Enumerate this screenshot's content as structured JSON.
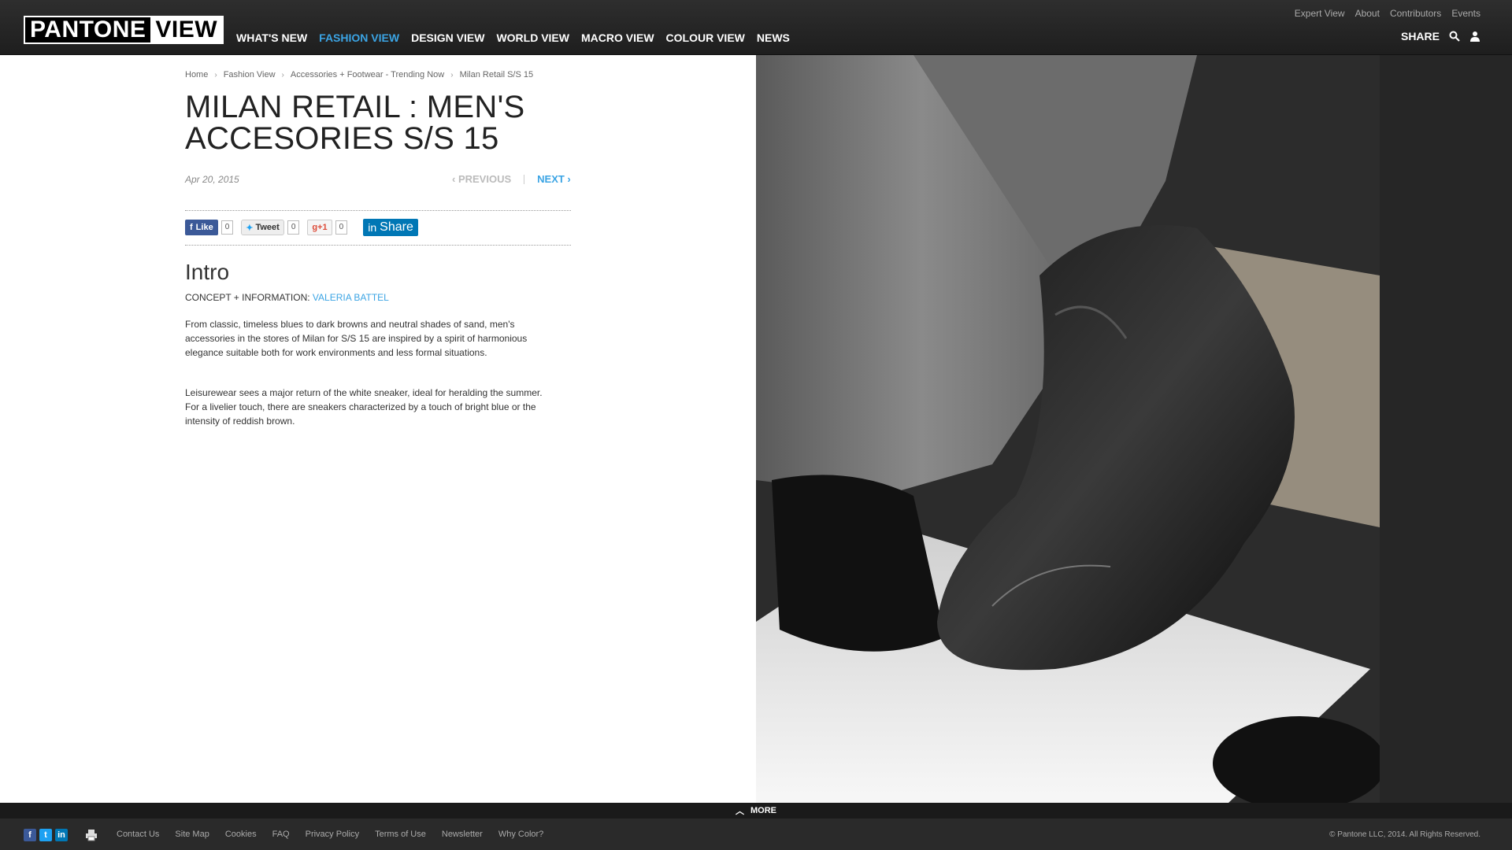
{
  "header": {
    "logo_left": "PANTONE",
    "logo_right": "VIEW",
    "main_nav": [
      {
        "label": "WHAT'S NEW"
      },
      {
        "label": "FASHION VIEW",
        "active": true
      },
      {
        "label": "DESIGN VIEW"
      },
      {
        "label": "WORLD VIEW"
      },
      {
        "label": "MACRO VIEW"
      },
      {
        "label": "COLOUR VIEW"
      },
      {
        "label": "NEWS"
      }
    ],
    "top_nav": [
      "Expert View",
      "About",
      "Contributors",
      "Events"
    ],
    "share_label": "SHARE"
  },
  "breadcrumb": [
    "Home",
    "Fashion View",
    "Accessories + Footwear - Trending Now",
    "Milan Retail S/S 15"
  ],
  "article": {
    "title": "MILAN RETAIL : MEN'S ACCESORIES S/S 15",
    "date": "Apr 20, 2015",
    "prev_label": "PREVIOUS",
    "next_label": "NEXT",
    "intro_heading": "Intro",
    "concept_label": "CONCEPT + INFORMATION:",
    "author": "VALERIA BATTEL",
    "paragraphs": [
      "From classic, timeless blues to dark browns and neutral shades of sand, men's accessories in the stores of Milan for S/S 15 are inspired by a spirit of harmonious elegance suitable both for work environments and less formal situations.",
      "Leisurewear sees a major return of the white sneaker, ideal for heralding the summer. For a livelier touch, there are sneakers characterized by a touch of bright blue or the intensity of reddish brown."
    ]
  },
  "social": {
    "facebook_label": "Like",
    "facebook_count": "0",
    "twitter_label": "Tweet",
    "twitter_count": "0",
    "gplus_label": "+1",
    "gplus_count": "0",
    "linkedin_label": "Share"
  },
  "footer": {
    "more_label": "MORE",
    "links": [
      "Contact Us",
      "Site Map",
      "Cookies",
      "FAQ",
      "Privacy Policy",
      "Terms of Use",
      "Newsletter",
      "Why Color?"
    ],
    "copyright": "© Pantone LLC, 2014. All Rights Reserved."
  },
  "colors": {
    "accent": "#3ba4e4",
    "header_bg": "#222222"
  }
}
